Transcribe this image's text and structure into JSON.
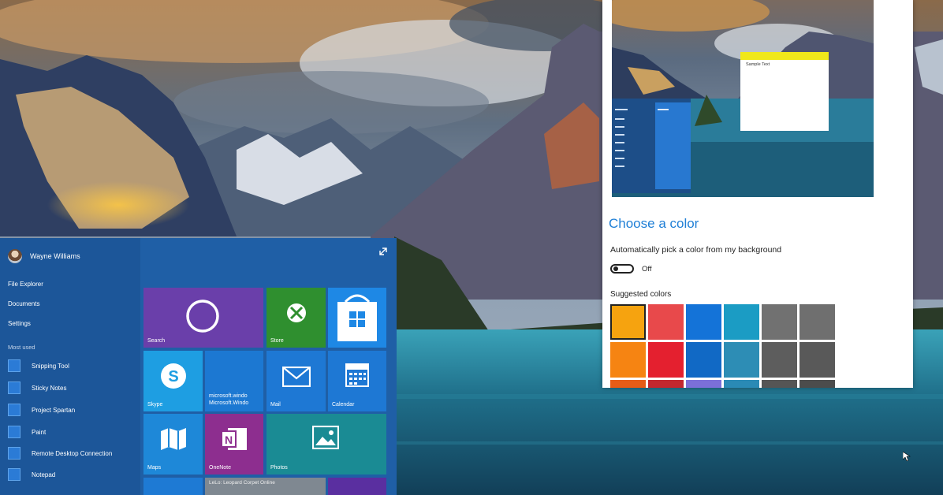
{
  "start_menu": {
    "user_name": "Wayne Williams",
    "places": [
      "File Explorer",
      "Documents",
      "Settings"
    ],
    "most_used_title": "Most used",
    "apps": [
      "Snipping Tool",
      "Sticky Notes",
      "Project Spartan",
      "Paint",
      "Remote Desktop Connection",
      "Notepad"
    ],
    "tiles": {
      "search": "Search",
      "store": "Store",
      "skype": "Skype",
      "microsoft_windows": "microsoft.windo Microsoft.Windo",
      "mail": "Mail",
      "calendar": "Calendar",
      "maps": "Maps",
      "onenote": "OneNote",
      "photos": "Photos",
      "news_strip": "LeLo: Leopard Corpet Online"
    }
  },
  "settings": {
    "preview_text": "Sample Text",
    "choose_color_title": "Choose a color",
    "auto_pick_label": "Automatically pick a color from my background",
    "toggle_state": "Off",
    "suggested_colors_label": "Suggested colors",
    "swatches": [
      {
        "color": "#f6a30f",
        "selected": true
      },
      {
        "color": "#e8494b",
        "selected": false
      },
      {
        "color": "#1473d8",
        "selected": false
      },
      {
        "color": "#1b9cc4",
        "selected": false
      },
      {
        "color": "#717171",
        "selected": false
      },
      {
        "color": "#6f6f6f",
        "selected": false
      },
      {
        "color": "#f68412",
        "selected": false
      },
      {
        "color": "#e4202f",
        "selected": false
      },
      {
        "color": "#1169c5",
        "selected": false
      },
      {
        "color": "#2d8db5",
        "selected": false
      },
      {
        "color": "#5d5d5d",
        "selected": false
      },
      {
        "color": "#595959",
        "selected": false
      }
    ]
  },
  "colors": {
    "accent_blue": "#1f5fa6",
    "search_tile": "#6a3faa",
    "store_tile": "#2f8f2f",
    "skype_tile": "#1e9ee2",
    "onenote_tile": "#8d2e8f",
    "photos_tile": "#1a8b94"
  }
}
